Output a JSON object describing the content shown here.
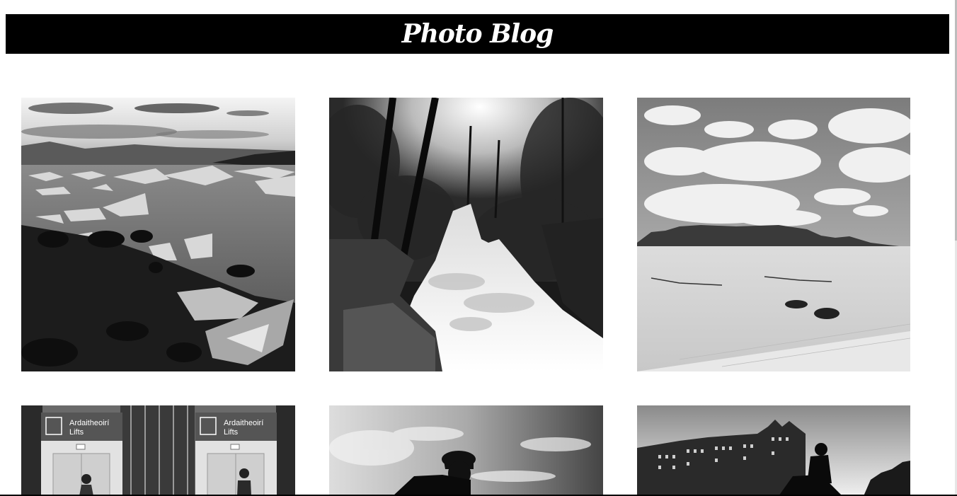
{
  "header": {
    "title": "Photo Blog"
  },
  "gallery": {
    "photos": [
      {
        "subject": "glacier lagoon with ice chunks on rocky shore"
      },
      {
        "subject": "forest waterfall"
      },
      {
        "subject": "desert sand dunes with mountains and clouds"
      },
      {
        "subject": "airport lifts signage",
        "sign_text_line1": "Ardaitheoirí",
        "sign_text_line2": "Lifts"
      },
      {
        "subject": "cyclist silhouette against sky"
      },
      {
        "subject": "cyclist silhouette in front of building"
      }
    ]
  },
  "colors": {
    "header_bg": "#000000",
    "header_text": "#ffffff",
    "page_bg": "#ffffff"
  }
}
